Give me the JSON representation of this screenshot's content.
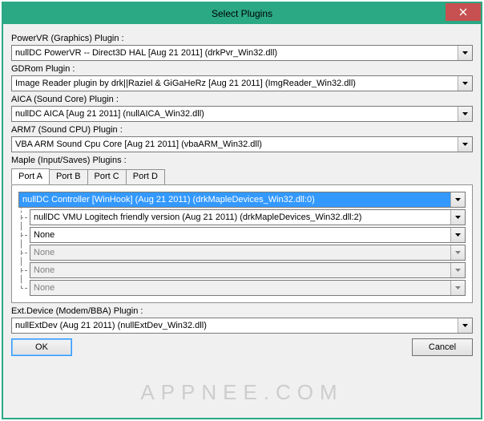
{
  "window": {
    "title": "Select Plugins"
  },
  "sections": {
    "powervr": {
      "label": "PowerVR (Graphics) Plugin :",
      "value": "nullDC PowerVR -- Direct3D HAL [Aug 21 2011] (drkPvr_Win32.dll)"
    },
    "gdrom": {
      "label": "GDRom Plugin :",
      "value": "Image Reader plugin by drk||Raziel & GiGaHeRz [Aug 21 2011] (ImgReader_Win32.dll)"
    },
    "aica": {
      "label": "AICA (Sound Core) Plugin :",
      "value": "nullDC AICA [Aug 21 2011] (nullAICA_Win32.dll)"
    },
    "arm7": {
      "label": "ARM7 (Sound CPU) Plugin :",
      "value": "VBA ARM Sound Cpu Core [Aug 21 2011] (vbaARM_Win32.dll)"
    },
    "maple": {
      "label": "Maple (Input/Saves) Plugins :",
      "tabs": [
        "Port A",
        "Port B",
        "Port C",
        "Port D"
      ],
      "activeTab": 0,
      "main": "nullDC Controller [WinHook] (Aug 21 2011) (drkMapleDevices_Win32.dll:0)",
      "subs": [
        {
          "value": "nullDC VMU Logitech friendly version (Aug 21 2011) (drkMapleDevices_Win32.dll:2)",
          "enabled": true
        },
        {
          "value": "None",
          "enabled": true
        },
        {
          "value": "None",
          "enabled": false
        },
        {
          "value": "None",
          "enabled": false
        },
        {
          "value": "None",
          "enabled": false
        }
      ]
    },
    "extdev": {
      "label": "Ext.Device (Modem/BBA) Plugin :",
      "value": "nullExtDev (Aug 21 2011) (nullExtDev_Win32.dll)"
    }
  },
  "buttons": {
    "ok": "OK",
    "cancel": "Cancel"
  },
  "watermark": "APPNEE.COM"
}
